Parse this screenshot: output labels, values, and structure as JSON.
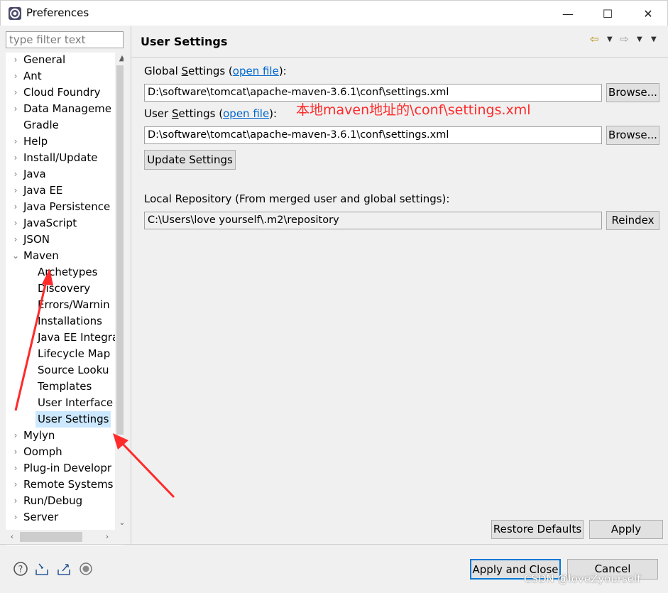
{
  "window": {
    "title": "Preferences",
    "minimize_glyph": "—",
    "maximize_glyph": "☐",
    "close_glyph": "✕"
  },
  "filter": {
    "placeholder": "type filter text",
    "value": ""
  },
  "tree": {
    "items": [
      {
        "label": "General",
        "expandable": true
      },
      {
        "label": "Ant",
        "expandable": true
      },
      {
        "label": "Cloud Foundry",
        "expandable": true
      },
      {
        "label": "Data Manageme",
        "expandable": true
      },
      {
        "label": "Gradle",
        "expandable": false
      },
      {
        "label": "Help",
        "expandable": true
      },
      {
        "label": "Install/Update",
        "expandable": true
      },
      {
        "label": "Java",
        "expandable": true
      },
      {
        "label": "Java EE",
        "expandable": true
      },
      {
        "label": "Java Persistence",
        "expandable": true
      },
      {
        "label": "JavaScript",
        "expandable": true
      },
      {
        "label": "JSON",
        "expandable": true
      },
      {
        "label": "Maven",
        "expandable": true,
        "expanded": true
      },
      {
        "label": "Archetypes",
        "child": true
      },
      {
        "label": "Discovery",
        "child": true
      },
      {
        "label": "Errors/Warnin",
        "child": true
      },
      {
        "label": "Installations",
        "child": true
      },
      {
        "label": "Java EE Integra",
        "child": true
      },
      {
        "label": "Lifecycle Map",
        "child": true
      },
      {
        "label": "Source Looku",
        "child": true
      },
      {
        "label": "Templates",
        "child": true
      },
      {
        "label": "User Interface",
        "child": true
      },
      {
        "label": "User Settings",
        "child": true,
        "selected": true
      },
      {
        "label": "Mylyn",
        "expandable": true
      },
      {
        "label": "Oomph",
        "expandable": true
      },
      {
        "label": "Plug-in Developr",
        "expandable": true
      },
      {
        "label": "Remote Systems",
        "expandable": true
      },
      {
        "label": "Run/Debug",
        "expandable": true
      },
      {
        "label": "Server",
        "expandable": true
      }
    ]
  },
  "page": {
    "title": "User Settings",
    "global_settings": {
      "label_prefix": "Global ",
      "label_mnemonic": "S",
      "label_rest": "ettings (",
      "link": "open file",
      "label_suffix": "):",
      "value": "D:\\software\\tomcat\\apache-maven-3.6.1\\conf\\settings.xml",
      "browse": "Browse..."
    },
    "user_settings": {
      "label_prefix": "User ",
      "label_mnemonic": "S",
      "label_rest": "ettings (",
      "link": "open file",
      "label_suffix": "):",
      "value": "D:\\software\\tomcat\\apache-maven-3.6.1\\conf\\settings.xml",
      "browse": "Browse..."
    },
    "update_button": "Update Settings",
    "local_repo": {
      "label": "Local Repository (From merged user and global settings):",
      "value": "C:\\Users\\love yourself\\.m2\\repository",
      "reindex": "Reindex"
    },
    "annotation": "本地maven地址的\\conf\\settings.xml",
    "restore_defaults": "Restore Defaults",
    "apply": "Apply"
  },
  "footer": {
    "apply_and_close": "Apply and Close",
    "cancel": "Cancel",
    "watermark": "CSDN @loveZyourself"
  },
  "colors": {
    "annotation": "#ff2a2a",
    "link": "#0066cc",
    "selection": "#cce8ff"
  }
}
